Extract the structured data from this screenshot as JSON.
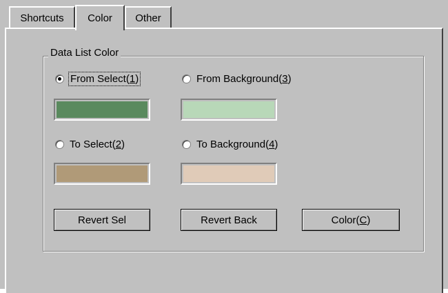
{
  "tabs": [
    {
      "label": "Shortcuts"
    },
    {
      "label": "Color"
    },
    {
      "label": "Other"
    }
  ],
  "group": {
    "title": "Data List Color"
  },
  "radios": {
    "from_select": {
      "text": "From Select",
      "accel": "1",
      "selected": true
    },
    "from_background": {
      "text": "From Background",
      "accel": "3",
      "selected": false
    },
    "to_select": {
      "text": "To Select",
      "accel": "2",
      "selected": false
    },
    "to_background": {
      "text": "To Background",
      "accel": "4",
      "selected": false
    }
  },
  "colors": {
    "from_select": "#5a8a5e",
    "from_background": "#b8d8b8",
    "to_select": "#b09a78",
    "to_background": "#e0cbb8"
  },
  "buttons": {
    "revert_sel": "Revert Sel",
    "revert_back": "Revert Back",
    "color": {
      "text": "Color",
      "accel": "C"
    }
  }
}
